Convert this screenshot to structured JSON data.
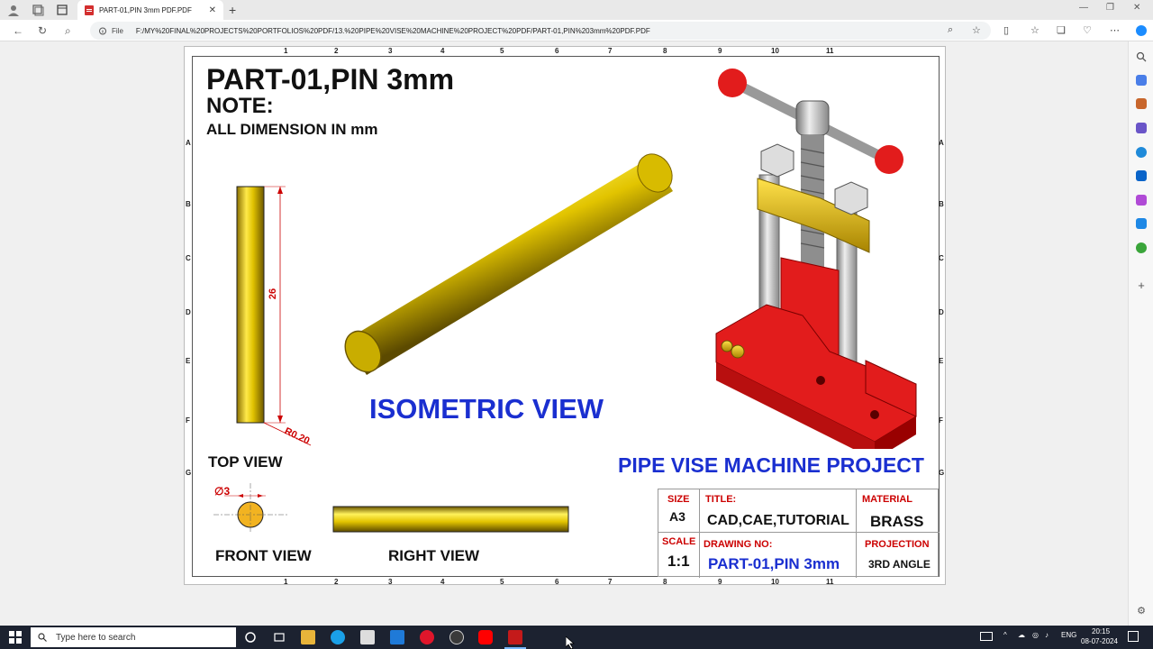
{
  "browser": {
    "tab_title": "PART-01,PIN 3mm PDF.PDF",
    "url_label": "File",
    "url": "F:/MY%20FINAL%20PROJECTS%20PORTFOLIOS%20PDF/13.%20PIPE%20VISE%20MACHINE%20PROJECT%20PDF/PART-01,PIN%203mm%20PDF.PDF"
  },
  "drawing": {
    "title": "PART-01,PIN 3mm",
    "note": "NOTE:",
    "note_text": "ALL DIMENSION IN mm",
    "isometric_label": "ISOMETRIC VIEW",
    "project_label": "PIPE VISE MACHINE PROJECT",
    "top_view_label": "TOP VIEW",
    "front_view_label": "FRONT VIEW",
    "right_view_label": "RIGHT VIEW",
    "dim_length": "26",
    "dim_radius": "R0.20",
    "dim_diameter_symbol": "∅",
    "dim_diameter": "3",
    "zones_cols": [
      "1",
      "2",
      "3",
      "4",
      "5",
      "6",
      "7",
      "8",
      "9",
      "10",
      "11"
    ],
    "zones_rows": [
      "A",
      "B",
      "C",
      "D",
      "E",
      "F",
      "G"
    ],
    "accent_blue": "#1a2fd0",
    "brass_color": "#e0c200",
    "vise_red": "#e21c1c"
  },
  "titleblock": {
    "size_label": "SIZE",
    "size_value": "A3",
    "title_label": "TITLE:",
    "title_value": "CAD,CAE,TUTORIAL",
    "material_label": "MATERIAL",
    "material_value": "BRASS",
    "scale_label": "SCALE",
    "scale_value": "1:1",
    "drawing_no_label": "DRAWING NO:",
    "drawing_no_value": "PART-01,PIN 3mm",
    "projection_label": "PROJECTION",
    "projection_value": "3RD ANGLE"
  },
  "taskbar": {
    "search_placeholder": "Type here to search",
    "lang": "ENG",
    "time": "20:15",
    "date": "08-07-2024"
  }
}
